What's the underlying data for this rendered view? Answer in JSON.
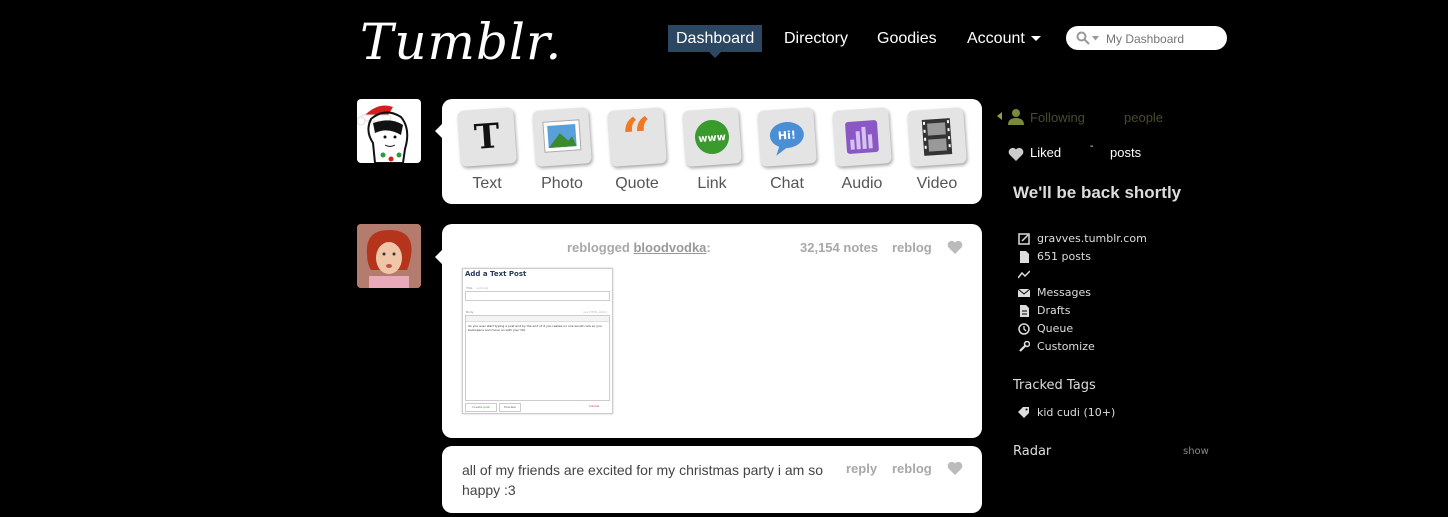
{
  "header": {
    "logo": "Tumblr.",
    "nav": [
      "Dashboard",
      "Directory",
      "Goodies",
      "Account"
    ],
    "search_placeholder": "My Dashboard"
  },
  "post_types": [
    "Text",
    "Photo",
    "Quote",
    "Link",
    "Chat",
    "Audio",
    "Video"
  ],
  "post1": {
    "action": "reblogged",
    "user": "bloodvodka",
    "colon": ":",
    "notes": "32,154 notes",
    "reblog": "reblog",
    "thumb": {
      "title": "Add a Text Post",
      "title_field": "Title",
      "title_hint": "optional",
      "body_field": "Body",
      "body_hint": "use HTML editor",
      "body_text": "do you ever start typing a post and by the end of it you realize no one would care so you backspace and move on with your life",
      "create_btn": "Create post",
      "preview_btn": "Preview",
      "cancel_btn": "Cancel"
    }
  },
  "post2": {
    "text": "all of my friends are excited for my christmas party i am so happy :3",
    "reply": "reply",
    "reblog": "reblog"
  },
  "sidebar": {
    "following": "Following",
    "following_count": "",
    "people": "people",
    "liked": "Liked",
    "liked_count": "-",
    "posts": "posts",
    "announce": "We'll be back shortly",
    "links": [
      "gravves.tumblr.com",
      "651 posts",
      "",
      "Messages",
      "Drafts",
      "Queue",
      "Customize"
    ],
    "tracked_title": "Tracked Tags",
    "tag": "kid cudi (10+)",
    "radar": "Radar",
    "show": "show"
  },
  "colors": {
    "nav_active": "#2c4762",
    "background": "#000000"
  }
}
